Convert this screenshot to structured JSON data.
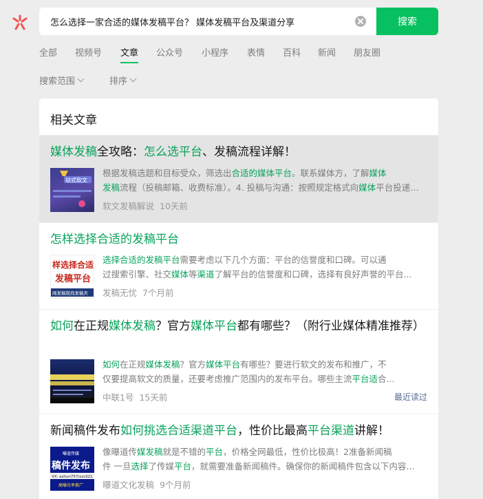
{
  "search": {
    "query": "怎么选择一家合适的媒体发稿平台？ 媒体发稿平台及渠道分享",
    "button_label": "搜索"
  },
  "tabs": [
    {
      "label": "全部",
      "active": false
    },
    {
      "label": "视频号",
      "active": false
    },
    {
      "label": "文章",
      "active": true
    },
    {
      "label": "公众号",
      "active": false
    },
    {
      "label": "小程序",
      "active": false
    },
    {
      "label": "表情",
      "active": false
    },
    {
      "label": "百科",
      "active": false
    },
    {
      "label": "新闻",
      "active": false
    },
    {
      "label": "朋友圈",
      "active": false
    }
  ],
  "filters": [
    {
      "label": "搜索范围"
    },
    {
      "label": "排序"
    }
  ],
  "panel": {
    "title": "相关文章"
  },
  "results": [
    {
      "title": [
        {
          "t": "媒体发稿",
          "hl": true
        },
        {
          "t": "全攻略：",
          "hl": false
        },
        {
          "t": "怎么选平台",
          "hl": true
        },
        {
          "t": "、发稿流程详解！",
          "hl": false
        }
      ],
      "snippet": [
        [
          {
            "t": "根据发稿选题和目标受众，筛选出",
            "hl": false
          },
          {
            "t": "合适的媒体平台",
            "hl": true
          },
          {
            "t": "。联系媒体方，了解",
            "hl": false
          },
          {
            "t": "媒体",
            "hl": true
          }
        ],
        [
          {
            "t": "发稿",
            "hl": true
          },
          {
            "t": "流程（投稿邮箱、收费标准）。4. 投稿与沟通：按照规定格式向",
            "hl": false
          },
          {
            "t": "媒体",
            "hl": true
          },
          {
            "t": "平台投递稿件...",
            "hl": false
          }
        ]
      ],
      "source": "软文发稿解说",
      "time": "10天前",
      "thumb_text": "站式软文",
      "hover": true
    },
    {
      "title": [
        {
          "t": "怎样选择合适的发稿平台",
          "hl": true
        }
      ],
      "snippet": [
        [
          {
            "t": "选择合适的发稿平台",
            "hl": true
          },
          {
            "t": "需要考虑以下几个方面：平台的信誉度和口碑。可以通",
            "hl": false
          }
        ],
        [
          {
            "t": "过搜索引擎、社交",
            "hl": false
          },
          {
            "t": "媒体",
            "hl": true
          },
          {
            "t": "等",
            "hl": false
          },
          {
            "t": "渠道",
            "hl": true
          },
          {
            "t": "了解平台的信誉度和口碑，选择有良好声誉的平台...",
            "hl": false
          }
        ]
      ],
      "source": "发稿无忧",
      "time": "7个月前",
      "thumb_lines": [
        "样选择合适",
        "发稿平台",
        "闻发稿就找发稿天"
      ]
    },
    {
      "title": [
        {
          "t": "如何",
          "hl": true
        },
        {
          "t": "在正规",
          "hl": false
        },
        {
          "t": "媒体发稿",
          "hl": true
        },
        {
          "t": "？官方",
          "hl": false
        },
        {
          "t": "媒体平台",
          "hl": true
        },
        {
          "t": "都有哪些？（附行业媒体精准推荐）",
          "hl": false
        }
      ],
      "snippet": [
        [
          {
            "t": "如何",
            "hl": true
          },
          {
            "t": "在正规",
            "hl": false
          },
          {
            "t": "媒体发稿",
            "hl": true
          },
          {
            "t": "？官方",
            "hl": false
          },
          {
            "t": "媒体平台",
            "hl": true
          },
          {
            "t": "有哪些？要进行软文的发布和推广，不",
            "hl": false
          }
        ],
        [
          {
            "t": "仅要提高软文的质量，还要考虑推广范围内的发布平台。哪些主流",
            "hl": false
          },
          {
            "t": "平台适",
            "hl": true
          },
          {
            "t": "合...",
            "hl": false
          }
        ]
      ],
      "source": "中联1号",
      "time": "15天前",
      "badge": "最近读过"
    },
    {
      "title": [
        {
          "t": "新闻稿件发布",
          "hl": false
        },
        {
          "t": "如何挑选合适渠道平台",
          "hl": true
        },
        {
          "t": "，性价比最高",
          "hl": false
        },
        {
          "t": "平台渠道",
          "hl": true
        },
        {
          "t": "讲解！",
          "hl": false
        }
      ],
      "snippet": [
        [
          {
            "t": "像曝道传",
            "hl": false
          },
          {
            "t": "媒发稿",
            "hl": true
          },
          {
            "t": "就是不错的",
            "hl": false
          },
          {
            "t": "平台",
            "hl": true
          },
          {
            "t": "，价格全网最低，性价比极高！2准备新闻稿",
            "hl": false
          }
        ],
        [
          {
            "t": "件 一旦",
            "hl": false
          },
          {
            "t": "选择",
            "hl": true
          },
          {
            "t": "了传媒",
            "hl": false
          },
          {
            "t": "平台",
            "hl": true
          },
          {
            "t": "，就需要准备新闻稿件。确保你的新闻稿件包含以下内容...",
            "hl": false
          }
        ]
      ],
      "source": "曝道文化发稿",
      "time": "9个月前",
      "thumb_lines": [
        "曝道传媒",
        "稿件发布",
        "VX: ashun757/xzs321",
        "高曝光率推广"
      ]
    }
  ],
  "colors": {
    "accent": "#07c160",
    "highlight": "#07a35a",
    "background": "#ededed",
    "link": "#576b95"
  }
}
